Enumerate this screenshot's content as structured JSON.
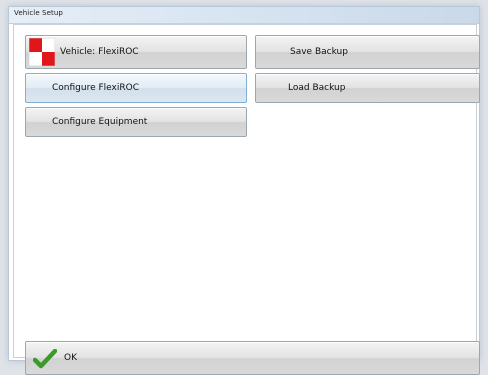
{
  "window": {
    "title": "Vehicle Setup"
  },
  "buttons": {
    "vehicle": "Vehicle: FlexiROC",
    "configure_flexiroc": "Configure FlexiROC",
    "configure_equipment": "Configure Equipment",
    "save_backup": "Save Backup",
    "load_backup": "Load Backup",
    "ok": "OK"
  },
  "icons": {
    "vehicle": "red-white-checkered-flag-icon",
    "ok": "green-checkmark-icon"
  },
  "colors": {
    "flag_red": "#e0161a",
    "check_green": "#3c9a2a",
    "selected_button_border": "#7fb1d8"
  }
}
